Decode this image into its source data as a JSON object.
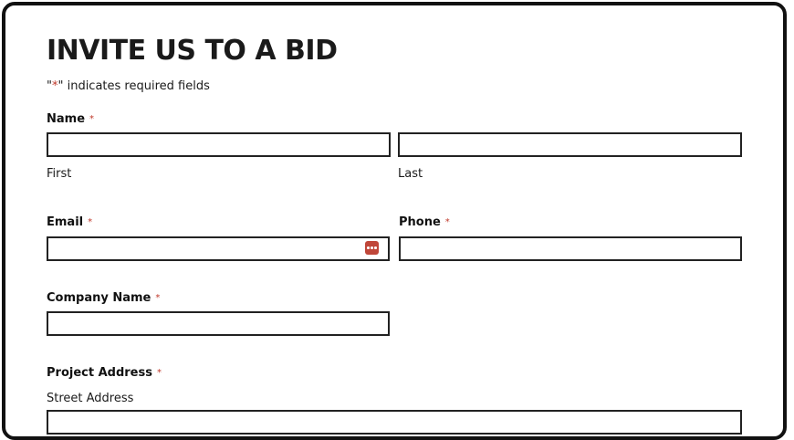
{
  "form": {
    "title": "INVITE US TO A BID",
    "required_note": {
      "quote_open": "\"",
      "star": "*",
      "text": "\" indicates required fields"
    },
    "required_marker": "*",
    "name": {
      "label": "Name",
      "first_value": "",
      "last_value": "",
      "first_sublabel": "First",
      "last_sublabel": "Last"
    },
    "email": {
      "label": "Email",
      "value": "",
      "icon": "password-manager-icon"
    },
    "phone": {
      "label": "Phone",
      "value": ""
    },
    "company": {
      "label": "Company Name",
      "value": ""
    },
    "address": {
      "label": "Project Address",
      "street_sublabel": "Street Address",
      "street_value": ""
    },
    "colors": {
      "required_star": "#c0392b",
      "icon_bg": "#c0473a",
      "border": "#222222"
    }
  }
}
